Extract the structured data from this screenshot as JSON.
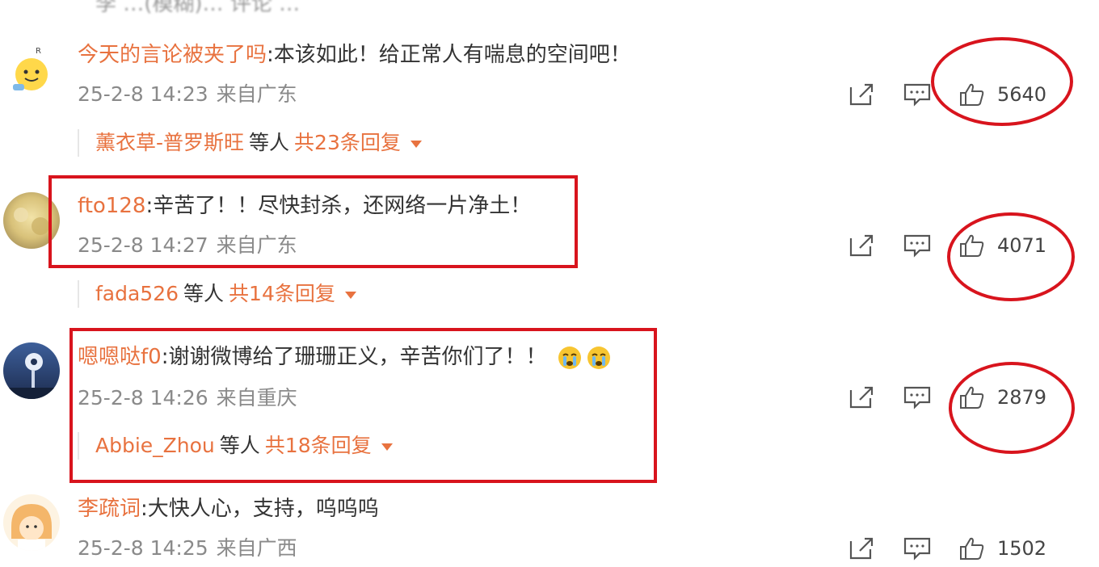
{
  "top_cut_text": "李 …(模糊)… 评论 …",
  "comments": [
    {
      "username": "今天的言论被夹了吗",
      "text": "本该如此！给正常人有喘息的空间吧！",
      "time": "25-2-8 14:23",
      "location": "来自广东",
      "likes": "5640",
      "reply_names": "薰衣草-普罗斯旺",
      "reply_mid": "等人",
      "reply_count": "共23条回复"
    },
    {
      "username": "fto128",
      "text": "辛苦了！！尽快封杀，还网络一片净土！",
      "time": "25-2-8 14:27",
      "location": "来自广东",
      "likes": "4071",
      "reply_names": "fada526",
      "reply_mid": "等人",
      "reply_count": "共14条回复"
    },
    {
      "username": "嗯嗯哒f0",
      "text": "谢谢微博给了珊珊正义，辛苦你们了！！",
      "time": "25-2-8 14:26",
      "location": "来自重庆",
      "likes": "2879",
      "reply_names": "Abbie_Zhou",
      "reply_mid": "等人",
      "reply_count": "共18条回复"
    },
    {
      "username": "李疏词",
      "text": "大快人心，支持，呜呜呜",
      "time": "25-2-8 14:25",
      "location": "来自广西",
      "likes": "1502"
    }
  ],
  "colon": ":",
  "colors": {
    "username": "#e8723f",
    "text": "#333333",
    "meta": "#8a8a8a",
    "annotation_red": "#d8141d"
  },
  "icons": [
    "share-icon",
    "comment-icon",
    "like-icon",
    "crying-emoji-icon"
  ]
}
